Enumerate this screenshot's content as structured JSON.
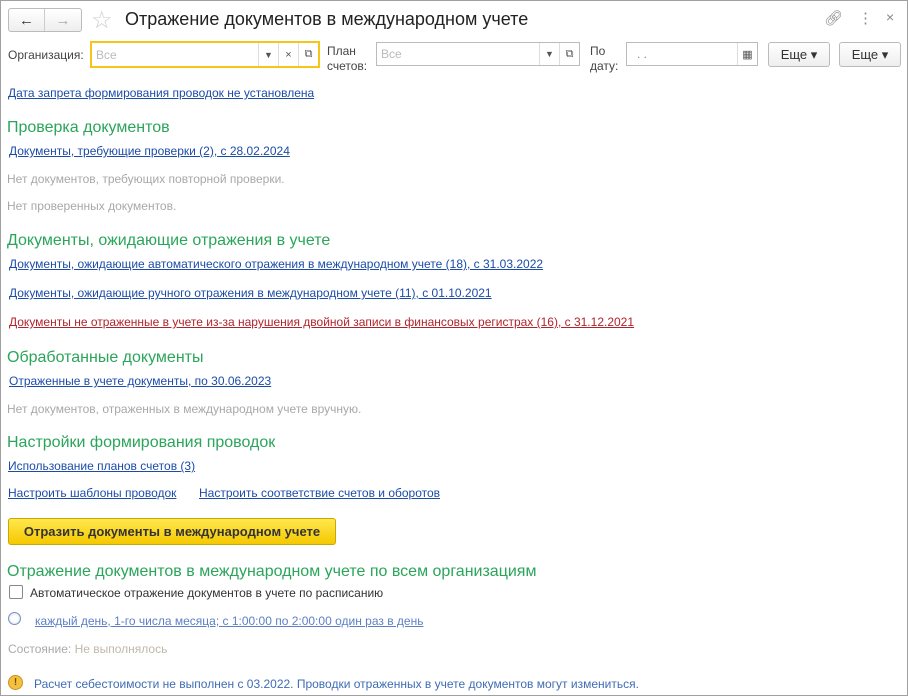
{
  "header": {
    "title": "Отражение документов в международном учете",
    "back": "←",
    "forward": "→"
  },
  "filters": {
    "org_label": "Организация:",
    "org_placeholder": "Все",
    "plan_label_1": "План",
    "plan_label_2": "счетов:",
    "plan_placeholder": "Все",
    "date_label_1": "По",
    "date_label_2": "дату:",
    "date_value": ". .",
    "more1": "Еще ▾",
    "more2": "Еще ▾"
  },
  "prohibition_link": "Дата запрета формирования проводок не установлена",
  "check": {
    "heading": "Проверка документов",
    "link": "Документы, требующие проверки (2), с 28.02.2024",
    "note1": "Нет документов, требующих повторной проверки.",
    "note2": "Нет проверенных документов."
  },
  "pending": {
    "heading": "Документы, ожидающие отражения в учете",
    "link1": "Документы, ожидающие автоматического отражения в международном учете (18), с 31.03.2022",
    "link2": "Документы, ожидающие ручного отражения в международном учете (11), с 01.10.2021",
    "link3": "Документы не отраженные в учете из-за нарушения двойной записи в финансовых регистрах (16), с 31.12.2021"
  },
  "processed": {
    "heading": "Обработанные документы",
    "link": "Отраженные в учете документы, по 30.06.2023",
    "note": "Нет документов, отраженных в международном учете вручную."
  },
  "settings": {
    "heading": "Настройки формирования проводок",
    "link1": "Использование планов счетов (3)",
    "link2": "Настроить шаблоны проводок",
    "link3": "Настроить соответствие счетов и оборотов"
  },
  "action_button": "Отразить документы в международном учете",
  "all_orgs": {
    "heading": "Отражение документов в международном учете по всем организациям",
    "checkbox_label": "Автоматическое отражение документов в учете по расписанию",
    "checkbox_checked": false,
    "schedule": "каждый день, 1-го числа месяца; с 1:00:00 по 2:00:00 один раз в день",
    "state_label": "Состояние:",
    "state_value": "Не выполнялось",
    "warning": "Расчет себестоимости не выполнен с 03.2022. Проводки отраженных в учете документов могут измениться."
  }
}
